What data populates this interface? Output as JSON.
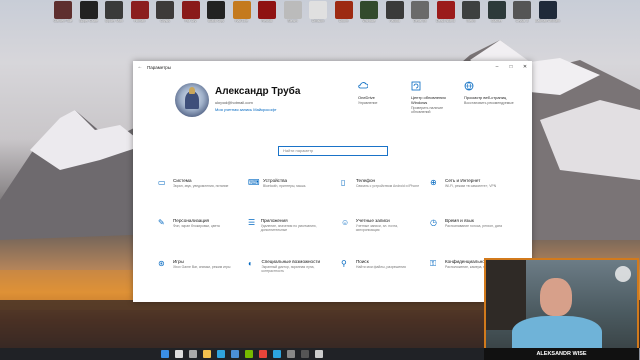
{
  "desktop_icons": [
    {
      "label": "Garden Tale",
      "color": "#5e2f2f"
    },
    {
      "label": "Super Crate",
      "color": "#222"
    },
    {
      "label": "Spider Man",
      "color": "#3a3a3a"
    },
    {
      "label": "Hitman",
      "color": "#8b1e1e"
    },
    {
      "label": "Crysis",
      "color": "#3d3a3a"
    },
    {
      "label": "Far Cry",
      "color": "#8a1a1a"
    },
    {
      "label": "Black Ops",
      "color": "#222"
    },
    {
      "label": "Half-Life",
      "color": "#c47a1e"
    },
    {
      "label": "Redfall",
      "color": "#8f1212"
    },
    {
      "label": "Steam",
      "color": "#bbbbbb"
    },
    {
      "label": "Division",
      "color": "#e0e0e0"
    },
    {
      "label": "Doom",
      "color": "#9d2a12"
    },
    {
      "label": "Warface",
      "color": "#324a2c"
    },
    {
      "label": "Fallout",
      "color": "#3a3a3a"
    },
    {
      "label": "Deus Ex",
      "color": "#6a6a6a"
    },
    {
      "label": "Dead Island",
      "color": "#9b1b1b"
    },
    {
      "label": "Metro",
      "color": "#3d4040"
    },
    {
      "label": "Stalker",
      "color": "#2d3a3a"
    },
    {
      "label": "Crysis 3",
      "color": "#555"
    },
    {
      "label": "Batman Arkham",
      "color": "#1f2a3a"
    }
  ],
  "window": {
    "title": "Параметры",
    "profile": {
      "name": "Александр Труба",
      "email": "ukrpod@hotmail.com",
      "link": "Моя учетная запись Майкрософт"
    },
    "quick": [
      {
        "title": "OneDrive",
        "sub": "Управление",
        "icon": "cloud-icon"
      },
      {
        "title": "Центр обновления Windows",
        "sub": "Проверить наличие обновлений",
        "icon": "update-icon"
      },
      {
        "title": "Просмотр веб-страниц",
        "sub": "Восстановить рекомендуемые",
        "icon": "globe-icon"
      }
    ],
    "search_placeholder": "Найти параметр",
    "categories": [
      {
        "title": "Система",
        "desc": "Экран, звук, уведомления, питание",
        "icon": "laptop-icon",
        "glyph": "▭"
      },
      {
        "title": "Устройства",
        "desc": "Bluetooth, принтеры, мышь",
        "icon": "devices-icon",
        "glyph": "⌨"
      },
      {
        "title": "Телефон",
        "desc": "Связать с устройством Android и iPhone",
        "icon": "phone-icon",
        "glyph": "▯"
      },
      {
        "title": "Сеть и Интернет",
        "desc": "Wi-Fi, режим «в самолете», VPN",
        "icon": "globe-icon",
        "glyph": "⊕"
      },
      {
        "title": "Персонализация",
        "desc": "Фон, экран блокировки, цвета",
        "icon": "brush-icon",
        "glyph": "✎"
      },
      {
        "title": "Приложения",
        "desc": "Удаление, значения по умолчанию, дополнительные",
        "icon": "apps-icon",
        "glyph": "☰"
      },
      {
        "title": "Учетные записи",
        "desc": "Учетные записи, эл. почта, синхронизация",
        "icon": "person-icon",
        "glyph": "☺"
      },
      {
        "title": "Время и язык",
        "desc": "Распознавание голоса, регион, дата",
        "icon": "clock-icon",
        "glyph": "◷"
      },
      {
        "title": "Игры",
        "desc": "Xbox Game Bar, снимки, режим игры",
        "icon": "xbox-icon",
        "glyph": "⊛"
      },
      {
        "title": "Специальные возможности",
        "desc": "Экранный диктор, экранная лупа, контрастность",
        "icon": "accessibility-icon",
        "glyph": "◐"
      },
      {
        "title": "Поиск",
        "desc": "Найти мои файлы, разрешения",
        "icon": "search-icon",
        "glyph": "⚲"
      },
      {
        "title": "Конфиденциальность",
        "desc": "Расположение, камера, микрофон",
        "icon": "lock-icon",
        "glyph": "⚿"
      }
    ]
  },
  "webcam": {
    "name": "ALEKSANDR WISE"
  },
  "taskbar": [
    {
      "icon": "windows-icon",
      "color": "#3a8ee6"
    },
    {
      "icon": "search-icon",
      "color": "#ddd"
    },
    {
      "icon": "taskview-icon",
      "color": "#aaa"
    },
    {
      "icon": "explorer-icon",
      "color": "#f2c14e"
    },
    {
      "icon": "edge-icon",
      "color": "#2fa3dc"
    },
    {
      "icon": "store-icon",
      "color": "#4a8fd8"
    },
    {
      "icon": "nvidia-icon",
      "color": "#76b900"
    },
    {
      "icon": "chrome-icon",
      "color": "#e8443a"
    },
    {
      "icon": "telegram-icon",
      "color": "#2ca5e0"
    },
    {
      "icon": "app-icon",
      "color": "#888"
    },
    {
      "icon": "obs-icon",
      "color": "#555"
    },
    {
      "icon": "settings-icon",
      "color": "#ccc"
    }
  ]
}
